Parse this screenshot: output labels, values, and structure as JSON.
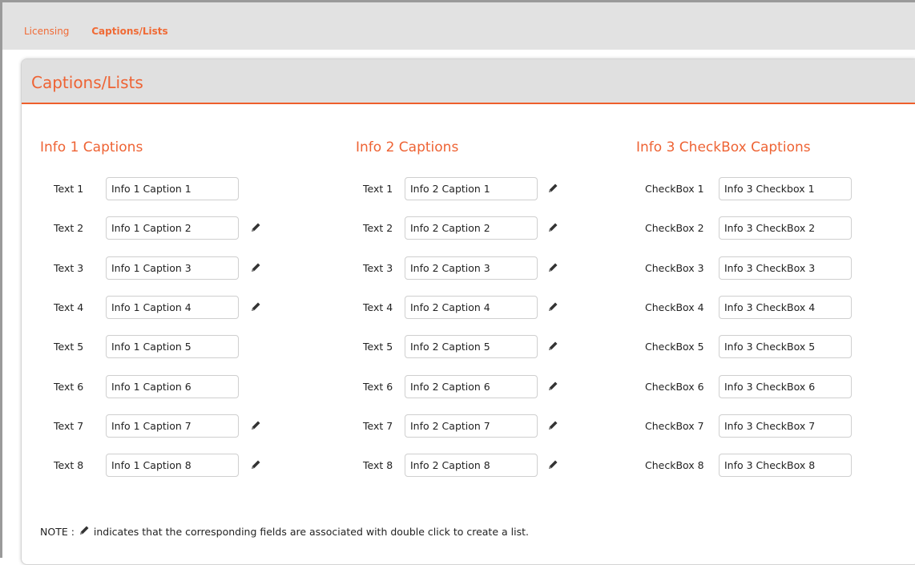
{
  "breadcrumb": {
    "items": [
      "Licensing",
      "Captions/Lists"
    ]
  },
  "panel": {
    "title": "Captions/Lists"
  },
  "sections": [
    {
      "title": "Info 1 Captions",
      "rows": [
        {
          "label": "Text 1",
          "value": "Info 1 Caption 1",
          "has_list": false
        },
        {
          "label": "Text 2",
          "value": "Info 1 Caption 2",
          "has_list": true
        },
        {
          "label": "Text 3",
          "value": "Info 1 Caption 3",
          "has_list": true
        },
        {
          "label": "Text 4",
          "value": "Info 1 Caption 4",
          "has_list": true
        },
        {
          "label": "Text 5",
          "value": "Info 1 Caption 5",
          "has_list": false
        },
        {
          "label": "Text 6",
          "value": "Info 1 Caption 6",
          "has_list": false
        },
        {
          "label": "Text 7",
          "value": "Info 1 Caption 7",
          "has_list": true
        },
        {
          "label": "Text 8",
          "value": "Info 1 Caption 8",
          "has_list": true
        }
      ]
    },
    {
      "title": "Info 2 Captions",
      "rows": [
        {
          "label": "Text 1",
          "value": "Info 2 Caption 1",
          "has_list": true
        },
        {
          "label": "Text 2",
          "value": "Info 2 Caption 2",
          "has_list": true
        },
        {
          "label": "Text 3",
          "value": "Info 2 Caption 3",
          "has_list": true
        },
        {
          "label": "Text 4",
          "value": "Info 2 Caption 4",
          "has_list": true
        },
        {
          "label": "Text 5",
          "value": "Info 2 Caption 5",
          "has_list": true
        },
        {
          "label": "Text 6",
          "value": "Info 2 Caption 6",
          "has_list": true
        },
        {
          "label": "Text 7",
          "value": "Info 2 Caption 7",
          "has_list": true
        },
        {
          "label": "Text 8",
          "value": "Info 2 Caption 8",
          "has_list": true
        }
      ]
    },
    {
      "title": "Info 3 CheckBox Captions",
      "rows": [
        {
          "label": "CheckBox 1",
          "value": "Info 3 Checkbox 1",
          "has_list": false
        },
        {
          "label": "CheckBox 2",
          "value": "Info 3 CheckBox 2",
          "has_list": false
        },
        {
          "label": "CheckBox 3",
          "value": "Info 3 CheckBox 3",
          "has_list": false
        },
        {
          "label": "CheckBox 4",
          "value": "Info 3 CheckBox 4",
          "has_list": false
        },
        {
          "label": "CheckBox 5",
          "value": "Info 3 CheckBox 5",
          "has_list": false
        },
        {
          "label": "CheckBox 6",
          "value": "Info 3 CheckBox 6",
          "has_list": false
        },
        {
          "label": "CheckBox 7",
          "value": "Info 3 CheckBox 7",
          "has_list": false
        },
        {
          "label": "CheckBox 8",
          "value": "Info 3 CheckBox 8",
          "has_list": false
        }
      ]
    }
  ],
  "note": {
    "prefix": "NOTE : ",
    "icon": "pencil-icon",
    "text": " indicates that the corresponding fields are associated with double click to create a list."
  },
  "colors": {
    "accent": "#ee6334",
    "header_bg": "#e0e0e0",
    "topbar_bg": "#e2e2e2"
  }
}
